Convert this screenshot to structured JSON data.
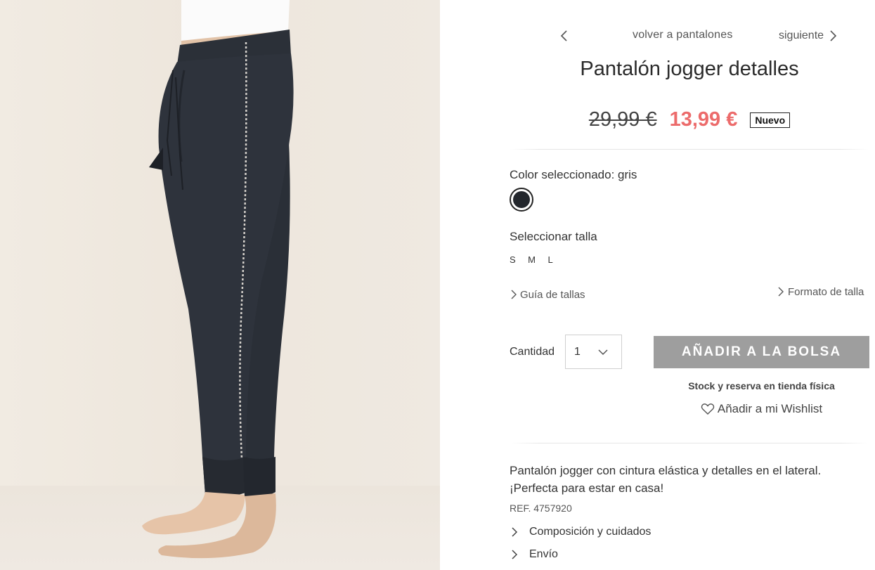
{
  "nav": {
    "prev_icon": "chevron-left-icon",
    "back_label": "volver a pantalones",
    "next_label": "siguiente",
    "next_icon": "chevron-right-icon"
  },
  "product": {
    "title": "Pantalón jogger detalles",
    "price_old": "29,99 €",
    "price_new": "13,99 €",
    "badge": "Nuevo",
    "price_new_color": "#ec6b6b"
  },
  "color": {
    "label": "Color seleccionado: gris",
    "swatches": [
      {
        "name": "gris",
        "hex": "#23272d",
        "selected": true
      }
    ]
  },
  "size": {
    "label": "Seleccionar talla",
    "options": [
      "S",
      "M",
      "L"
    ],
    "guide_label": "Guía de tallas",
    "format_label": "Formato de talla"
  },
  "purchase": {
    "qty_label": "Cantidad",
    "qty_value": "1",
    "add_button": "AÑADIR A LA BOLSA",
    "add_button_color": "#9e9e9e",
    "stock_label": "Stock y reserva en tienda física",
    "wishlist_label": "Añadir a mi Wishlist"
  },
  "details": {
    "description": "Pantalón jogger con cintura elástica y detalles en el lateral. ¡Perfecta para estar en casa!",
    "ref": "REF. 4757920",
    "accordions": [
      "Composición y cuidados",
      "Envío"
    ]
  }
}
